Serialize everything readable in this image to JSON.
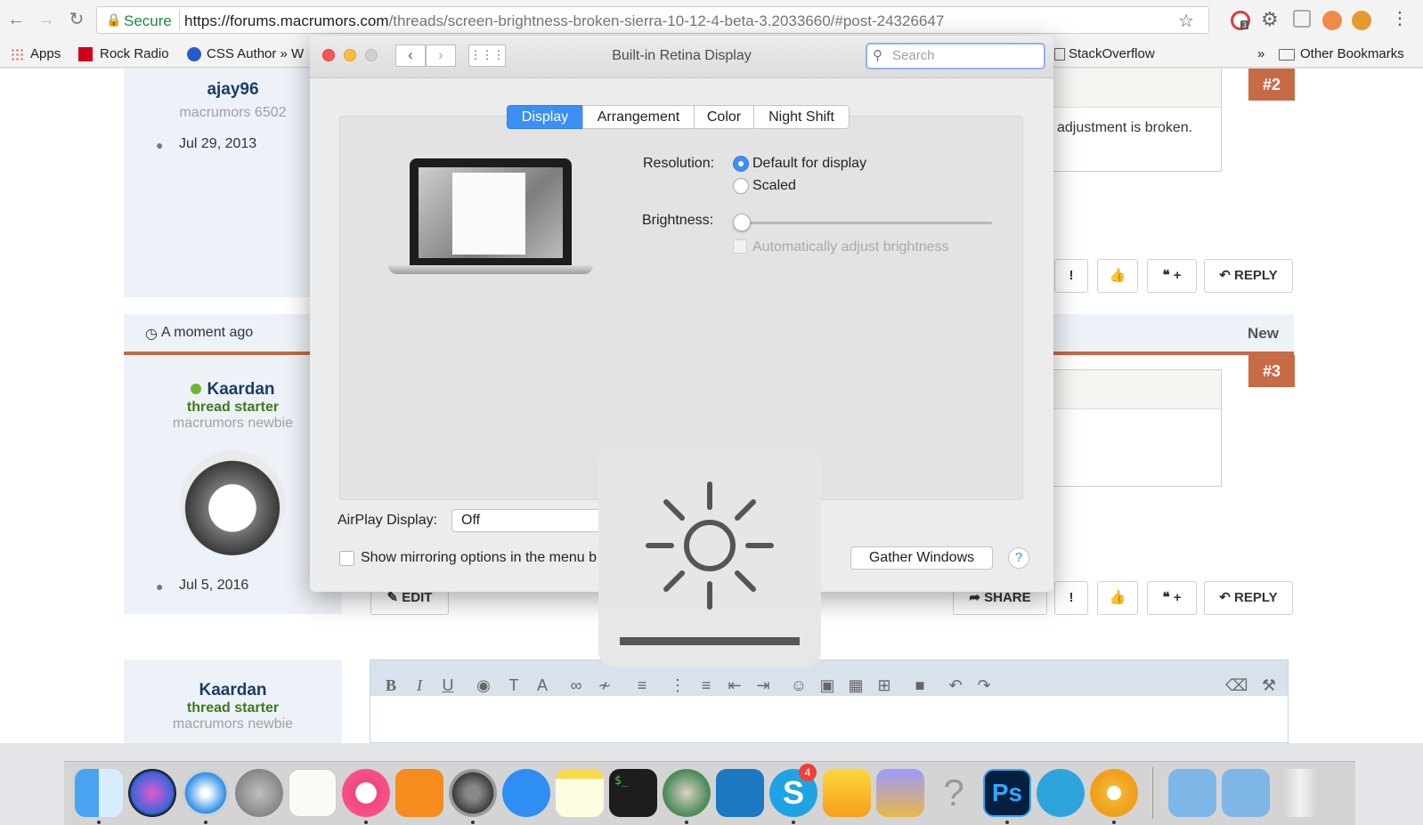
{
  "browser": {
    "url_secure": "Secure",
    "url_domain": "https://forums.macrumors.com",
    "url_path": "/threads/screen-brightness-broken-sierra-10-12-4-beta-3.2033660/#post-24326647",
    "bookmarks": [
      "Apps",
      "Rock Radio",
      "CSS Author » W",
      "StackOverflow",
      "Other Bookmarks"
    ],
    "overflow": "»",
    "ext_badge": "3"
  },
  "forum": {
    "post1": {
      "username": "ajay96",
      "rank": "macrumors 6502",
      "joined": "Jul 29, 2013",
      "number": "#2",
      "text_fragment": "adjustment is broken."
    },
    "post2": {
      "timestamp": "A moment ago",
      "new_label": "New",
      "username": "Kaardan",
      "role": "thread starter",
      "rank": "macrumors newbie",
      "joined": "Jul 5, 2016",
      "number": "#3"
    },
    "post3": {
      "username": "Kaardan",
      "role": "thread starter",
      "rank": "macrumors newbie"
    },
    "buttons": {
      "reply": "REPLY",
      "share": "SHARE",
      "edit": "EDIT",
      "multiquote": "+"
    }
  },
  "dialog": {
    "title": "Built-in Retina Display",
    "search_placeholder": "Search",
    "tabs": [
      "Display",
      "Arrangement",
      "Color",
      "Night Shift"
    ],
    "active_tab": "Display",
    "resolution_label": "Resolution:",
    "resolution_options": [
      "Default for display",
      "Scaled"
    ],
    "resolution_selected": "Default for display",
    "brightness_label": "Brightness:",
    "brightness_level": 0,
    "auto_brightness_label": "Automatically adjust brightness",
    "auto_brightness_checked": false,
    "airplay_label": "AirPlay Display:",
    "airplay_value": "Off",
    "mirroring_label": "Show mirroring options in the menu b",
    "gather_windows": "Gather Windows",
    "help": "?"
  },
  "hud": {
    "icon": "sun-icon",
    "level": 0
  },
  "dock": {
    "apps": [
      "Finder",
      "Siri",
      "Safari",
      "Launchpad",
      "TextEdit",
      "iTunes",
      "iBooks",
      "System Preferences",
      "App Store",
      "Notes",
      "Terminal",
      "Atom",
      "Visual Studio Code",
      "Skype",
      "Sketch",
      "Transmit",
      "Help",
      "Photoshop",
      "Telegram",
      "Chrome Canary",
      "Applications",
      "Downloads",
      "Trash"
    ],
    "skype_badge": "4",
    "ps_label": "Ps"
  },
  "colors": {
    "accent": "#3d8ef5",
    "post_number": "#c76a46",
    "username": "#1b3d66",
    "starter": "#3d7a1d"
  }
}
